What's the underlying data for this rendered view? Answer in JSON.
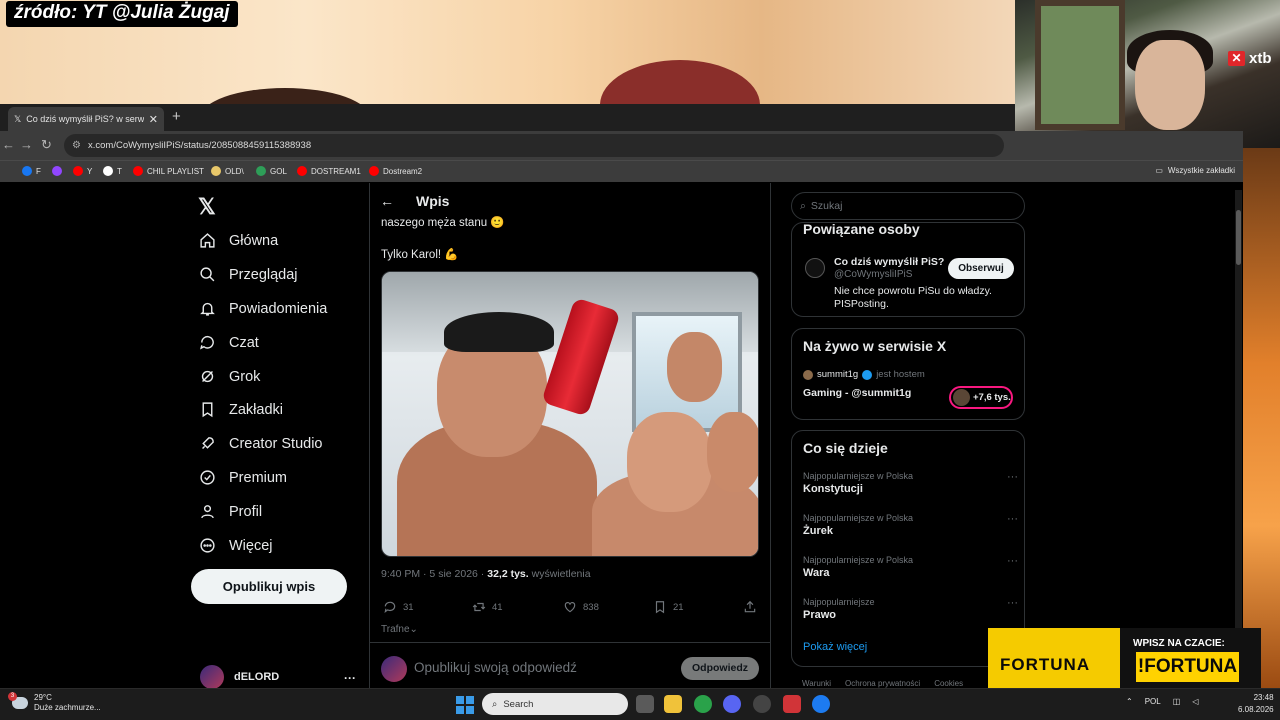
{
  "overlay": {
    "source_label": "źródło: YT @Julia Żugaj",
    "xtb_logo": "xtb"
  },
  "browser": {
    "tab_title": "Co dziś wymyślił PiS? w serwisie",
    "url": "x.com/CoWymysliIPiS/status/2085088459115388938",
    "bookmarks": [
      {
        "label": "F",
        "color": "#1877f2"
      },
      {
        "label": "",
        "color": "#9146ff"
      },
      {
        "label": "Y",
        "color": "#ff0000"
      },
      {
        "label": "T",
        "color": "#ffffff"
      },
      {
        "label": "CHIL PLAYLIST",
        "color": "#ff0000"
      },
      {
        "label": "OLD\\",
        "color": "#e8c76a"
      },
      {
        "label": "GOL",
        "color": "#2e9e58"
      },
      {
        "label": "DOSTREAM1",
        "color": "#ff0000"
      },
      {
        "label": "Dostream2",
        "color": "#ff0000"
      }
    ],
    "all_bookmarks": "Wszystkie zakładki"
  },
  "nav": {
    "items": [
      {
        "label": "Główna",
        "icon": "home-icon"
      },
      {
        "label": "Przeglądaj",
        "icon": "search-icon"
      },
      {
        "label": "Powiadomienia",
        "icon": "bell-icon"
      },
      {
        "label": "Czat",
        "icon": "chat-icon"
      },
      {
        "label": "Grok",
        "icon": "grok-icon"
      },
      {
        "label": "Zakładki",
        "icon": "bookmark-icon"
      },
      {
        "label": "Creator Studio",
        "icon": "rocket-icon"
      },
      {
        "label": "Premium",
        "icon": "verified-icon"
      },
      {
        "label": "Profil",
        "icon": "person-icon"
      },
      {
        "label": "Więcej",
        "icon": "more-icon"
      }
    ],
    "post_button": "Opublikuj wpis",
    "profile_name": "dELORD",
    "profile_more": "···"
  },
  "tweet": {
    "header_title": "Wpis",
    "text_line1": "naszego męża stanu 🙂",
    "text_line2": "Tylko Karol! 💪",
    "time": "9:40 PM · 5 sie 2026 · ",
    "views_count": "32,2 tys.",
    "views_label": " wyświetlenia",
    "replies": "31",
    "reposts": "41",
    "likes": "838",
    "bookmarks": "21",
    "sort_label": "Trafne",
    "reply_placeholder": "Opublikuj swoją odpowiedź",
    "reply_button": "Odpowiedz"
  },
  "sidebar": {
    "search_placeholder": "Szukaj",
    "related": {
      "title": "Powiązane osoby",
      "name": "Co dziś wymyślił PiS?",
      "handle": "@CoWymysliIPiS",
      "bio": "Nie chce powrotu PiSu do władzy. PISPosting.",
      "follow": "Obserwuj"
    },
    "live": {
      "title": "Na żywo w serwisie X",
      "host_name": "summit1g",
      "host_suffix": "jest hostem",
      "stream_title": "Gaming - @summit1g",
      "listeners": "+7,6 tys."
    },
    "trends": {
      "title": "Co się dzieje",
      "items": [
        {
          "context": "Najpopularniejsze w Polska",
          "name": "Konstytucji"
        },
        {
          "context": "Najpopularniejsze w Polska",
          "name": "Żurek"
        },
        {
          "context": "Najpopularniejsze w Polska",
          "name": "Wara"
        },
        {
          "context": "Najpopularniejsze",
          "name": "Prawo"
        }
      ],
      "show_more": "Pokaż więcej"
    },
    "footer": [
      "Warunki",
      "Ochrona prywatności",
      "Cookies"
    ]
  },
  "ad": {
    "brand": "FORTUNA",
    "cta": "WPISZ NA CZACIE:",
    "command": "!FORTUNA"
  },
  "taskbar": {
    "temperature": "29°C",
    "weather": "Duże zachmurze...",
    "notification_count": "3",
    "search": "Search",
    "language": "POL",
    "time": "23:48",
    "date": "6.08.2026"
  }
}
